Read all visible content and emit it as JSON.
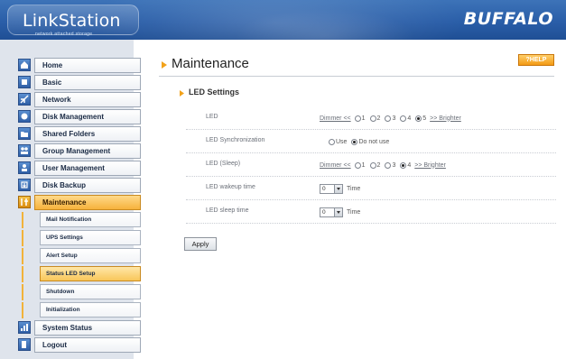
{
  "header": {
    "logo_text": "LinkStation",
    "logo_subtitle": "network attached storage",
    "brand": "BUFFALO"
  },
  "sidebar": {
    "items": [
      {
        "label": "Home",
        "icon": "home-icon"
      },
      {
        "label": "Basic",
        "icon": "basic-icon"
      },
      {
        "label": "Network",
        "icon": "network-icon"
      },
      {
        "label": "Disk Management",
        "icon": "disk-icon"
      },
      {
        "label": "Shared Folders",
        "icon": "folder-icon"
      },
      {
        "label": "Group Management",
        "icon": "group-icon"
      },
      {
        "label": "User Management",
        "icon": "user-icon"
      },
      {
        "label": "Disk Backup",
        "icon": "backup-icon"
      },
      {
        "label": "Maintenance",
        "icon": "tools-icon",
        "active": true
      },
      {
        "label": "System Status",
        "icon": "status-icon"
      },
      {
        "label": "Logout",
        "icon": "logout-icon"
      }
    ],
    "subitems": [
      {
        "label": "Mail Notification"
      },
      {
        "label": "UPS Settings"
      },
      {
        "label": "Alert Setup"
      },
      {
        "label": "Status LED Setup",
        "active": true
      },
      {
        "label": "Shutdown"
      },
      {
        "label": "Initialization"
      }
    ]
  },
  "main": {
    "title": "Maintenance",
    "help_label": "?HELP",
    "section_title": "LED Settings",
    "rows": {
      "led": {
        "label": "LED",
        "dimmer": "Dimmer <<",
        "options": [
          "1",
          "2",
          "3",
          "4",
          "5"
        ],
        "selected": "5",
        "brighter": ">> Brighter"
      },
      "sync": {
        "label": "LED Synchronization",
        "opt_use": "Use",
        "opt_donot": "Do not use",
        "selected": "Do not use"
      },
      "sleep": {
        "label": "LED (Sleep)",
        "dimmer": "Dimmer <<",
        "options": [
          "1",
          "2",
          "3",
          "4"
        ],
        "selected": "4",
        "brighter": ">> Brighter"
      },
      "wakeup": {
        "label": "LED wakeup time",
        "value": "0",
        "unit": "Time"
      },
      "sleeptime": {
        "label": "LED sleep time",
        "value": "0",
        "unit": "Time"
      }
    },
    "apply_label": "Apply"
  },
  "colors": {
    "header_blue": "#2a5ea8",
    "active_orange": "#f6b23c",
    "sidebar_bg": "#dfe4ec"
  }
}
